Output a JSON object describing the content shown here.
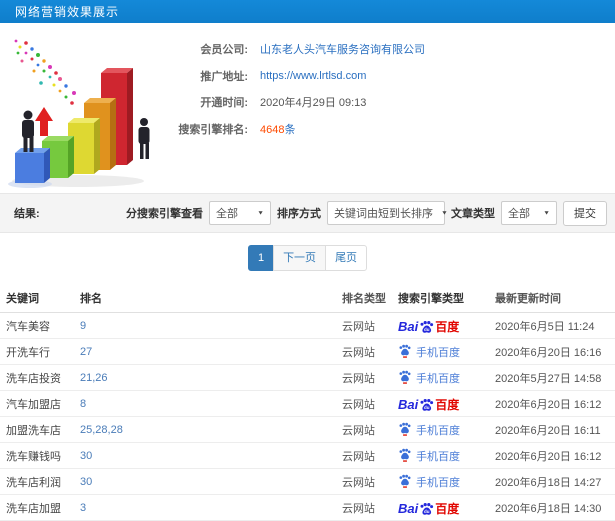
{
  "header": {
    "title": "网络营销效果展示"
  },
  "info": {
    "fields": [
      {
        "label": "会员公司:",
        "value": "山东老人头汽车服务咨询有限公司"
      },
      {
        "label": "推广地址:",
        "value": "https://www.lrtlsd.com"
      },
      {
        "label": "开通时间:",
        "value": "2020年4月29日 09:13"
      },
      {
        "label": "搜索引擎排名:",
        "value": "4648",
        "suffix": "条"
      }
    ],
    "illustration": "bar-chart-growth-illustration"
  },
  "filters": {
    "result_label": "结果:",
    "engine_label": "分搜索引擎查看",
    "engine_value": "全部",
    "sort_label": "排序方式",
    "sort_value": "关键词由短到长排序",
    "article_label": "文章类型",
    "article_value": "全部",
    "submit_label": "提交"
  },
  "icons": {
    "select_arrow": "▼"
  },
  "pagination": {
    "current": "1",
    "next_label": "下一页",
    "last_label": "尾页"
  },
  "table": {
    "headers": [
      "关键词",
      "排名",
      "排名类型",
      "搜索引擎类型",
      "最新更新时间"
    ],
    "engine_brands": {
      "baidu": {
        "prefix": "Bai",
        "suffix": "百度"
      },
      "mobile_baidu": {
        "label": "手机百度"
      }
    },
    "rows": [
      {
        "keyword": "汽车美容",
        "rank": "9",
        "rank_type": "云网站",
        "engine": "baidu",
        "updated": "2020年6月5日 11:24"
      },
      {
        "keyword": "开洗车行",
        "rank": "27",
        "rank_type": "云网站",
        "engine": "mobile_baidu",
        "updated": "2020年6月20日 16:16"
      },
      {
        "keyword": "洗车店投资",
        "rank": "21,26",
        "rank_type": "云网站",
        "engine": "mobile_baidu",
        "updated": "2020年5月27日 14:58"
      },
      {
        "keyword": "汽车加盟店",
        "rank": "8",
        "rank_type": "云网站",
        "engine": "baidu",
        "updated": "2020年6月20日 16:12"
      },
      {
        "keyword": "加盟洗车店",
        "rank": "25,28,28",
        "rank_type": "云网站",
        "engine": "mobile_baidu",
        "updated": "2020年6月20日 16:11"
      },
      {
        "keyword": "洗车赚钱吗",
        "rank": "30",
        "rank_type": "云网站",
        "engine": "mobile_baidu",
        "updated": "2020年6月20日 16:12"
      },
      {
        "keyword": "洗车店利润",
        "rank": "30",
        "rank_type": "云网站",
        "engine": "mobile_baidu",
        "updated": "2020年6月18日 14:27"
      },
      {
        "keyword": "洗车店加盟",
        "rank": "3",
        "rank_type": "云网站",
        "engine": "baidu",
        "updated": "2020年6月18日 14:30"
      }
    ]
  },
  "colors": {
    "header_blue": "#1182d2",
    "link_blue": "#2a6fc0",
    "rank_blue": "#4a7cb8",
    "highlight_orange": "#ff4a00",
    "pagination_active": "#337ab7",
    "baidu_blue": "#2428dc",
    "baidu_red": "#e10601",
    "mobile_baidu_blue": "#4a7cd6",
    "filter_bar_bg": "#f4f4f4"
  }
}
